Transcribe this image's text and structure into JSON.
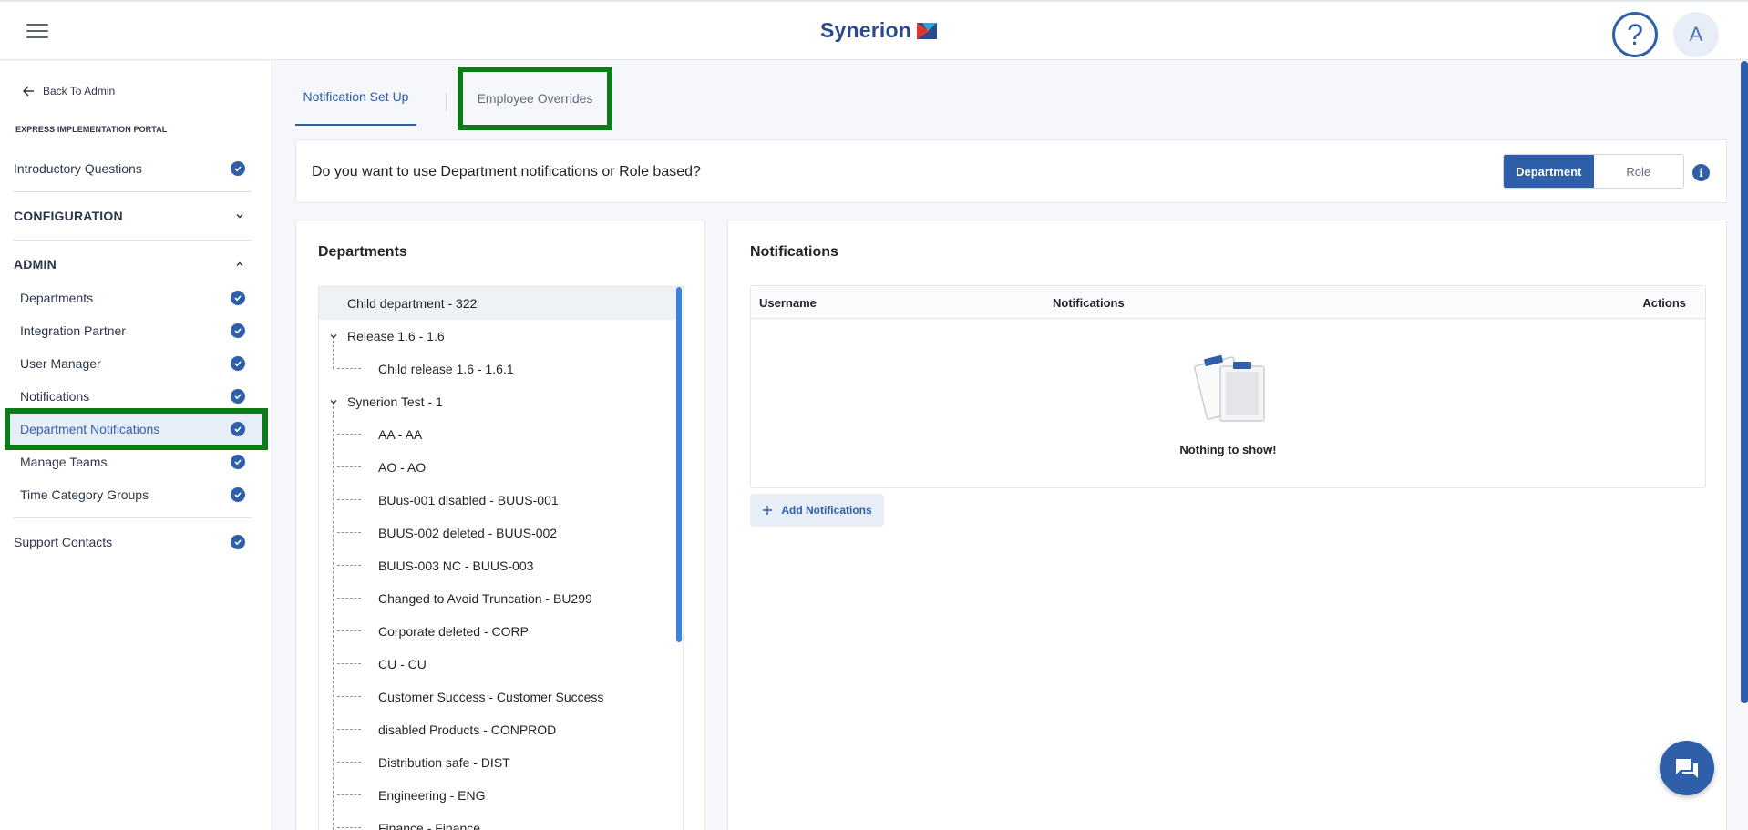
{
  "header": {
    "logo_text": "Synerion",
    "help_glyph": "?",
    "avatar_initial": "A"
  },
  "sidebar": {
    "back_label": "Back To Admin",
    "portal_title": "EXPRESS IMPLEMENTATION PORTAL",
    "intro": "Introductory Questions",
    "config": "CONFIGURATION",
    "admin": "ADMIN",
    "items": [
      "Departments",
      "Integration Partner",
      "User Manager",
      "Notifications",
      "Department Notifications",
      "Manage Teams",
      "Time Category Groups"
    ],
    "support": "Support Contacts"
  },
  "tabs": {
    "setup": "Notification Set Up",
    "overrides": "Employee Overrides"
  },
  "question": {
    "text": "Do you want to use Department notifications or Role based?",
    "option_department": "Department",
    "option_role": "Role",
    "info_glyph": "i"
  },
  "departments": {
    "title": "Departments",
    "tree": [
      "Child department - 322",
      "Release 1.6 - 1.6",
      "Child release 1.6 - 1.6.1",
      "Synerion Test - 1",
      "AA - AA",
      "AO - AO",
      "BUus-001 disabled - BUUS-001",
      "BUUS-002 deleted - BUUS-002",
      "BUUS-003 NC - BUUS-003",
      "Changed to Avoid Truncation - BU299",
      "Corporate deleted - CORP",
      "CU - CU",
      "Customer Success - Customer Success",
      "disabled Products - CONPROD",
      "Distribution safe - DIST",
      "Engineering - ENG",
      "Finance - Finance"
    ]
  },
  "notifications": {
    "title": "Notifications",
    "col_username": "Username",
    "col_notifications": "Notifications",
    "col_actions": "Actions",
    "empty_text": "Nothing to show!",
    "add_label": "Add Notifications"
  },
  "colors": {
    "primary": "#2f5fa8",
    "highlight": "#0f7a1a"
  }
}
